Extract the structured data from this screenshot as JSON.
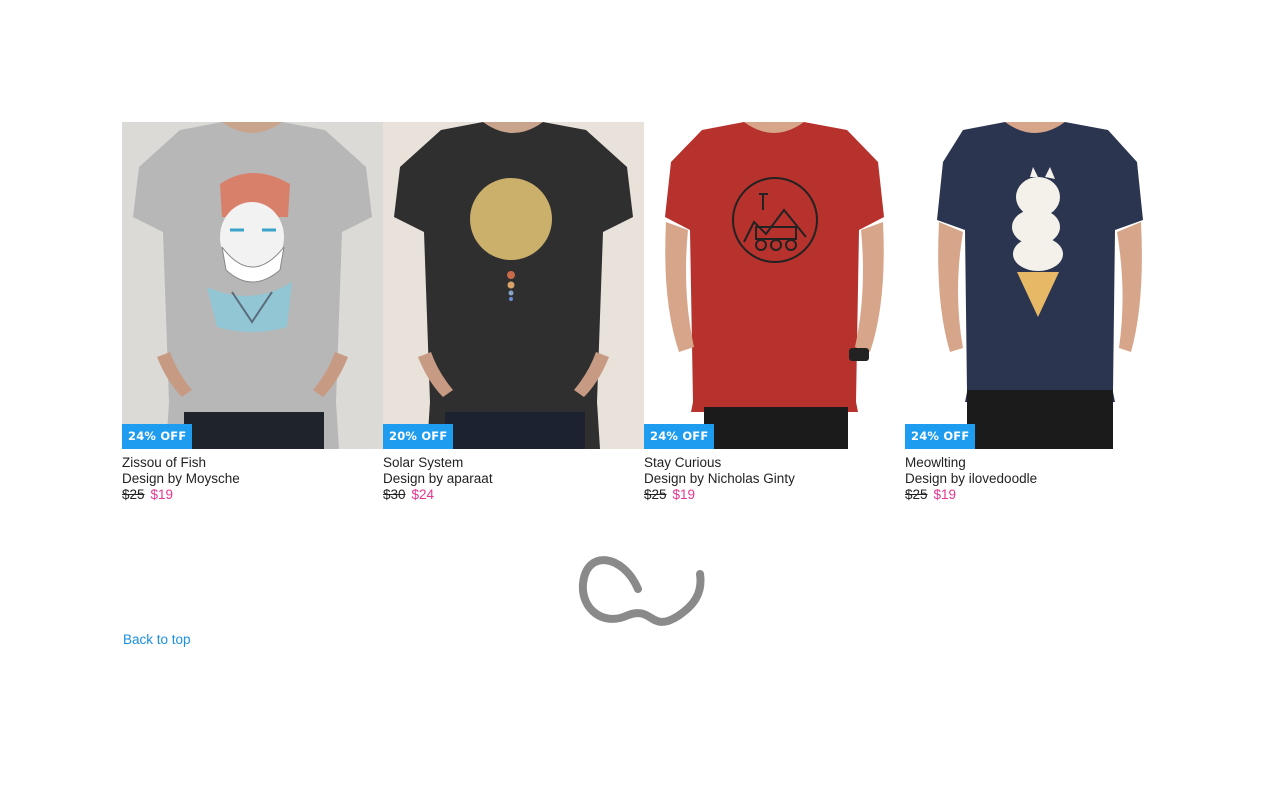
{
  "products": [
    {
      "title": "Zissou of Fish",
      "designer": "Design by Moysche",
      "old_price": "$25",
      "price": "$19",
      "badge": "24% OFF",
      "shirt_color": "#b7b7b8",
      "bg_color": "#dcdad6",
      "graphic": "portrait-graphic"
    },
    {
      "title": "Solar System",
      "designer": "Design by aparaat",
      "old_price": "$30",
      "price": "$24",
      "badge": "20% OFF",
      "shirt_color": "#2f2f30",
      "bg_color": "#e8e2da",
      "graphic": "planet-graphic"
    },
    {
      "title": "Stay Curious",
      "designer": "Design by Nicholas Ginty",
      "old_price": "$25",
      "price": "$19",
      "badge": "24% OFF",
      "shirt_color": "#b7312d",
      "bg_color": "#ffffff",
      "graphic": "rover-badge-graphic"
    },
    {
      "title": "Meowlting",
      "designer": "Design by ilovedoodle",
      "old_price": "$25",
      "price": "$19",
      "badge": "24% OFF",
      "shirt_color": "#2c3550",
      "bg_color": "#ffffff",
      "graphic": "cat-icecream-graphic"
    }
  ],
  "footer": {
    "back_to_top": "Back to top",
    "loader_icon": "loading-spinner-icon"
  },
  "colors": {
    "badge": "#1e9cf0",
    "sale_price": "#e8358e",
    "link": "#1a8fe3"
  }
}
